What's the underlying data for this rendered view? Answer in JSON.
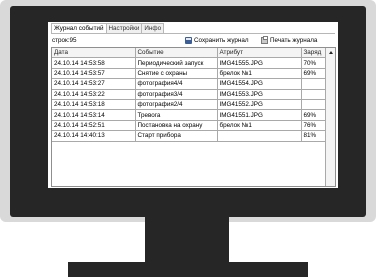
{
  "tabs": [
    "Журнал событий",
    "Настройки",
    "Инфо"
  ],
  "toolbar": {
    "count_label": "строк:95",
    "save_label": "Сохранить журнал",
    "print_label": "Печать журнала"
  },
  "table": {
    "columns": [
      "Дата",
      "Событие",
      "Атрибут",
      "Заряд"
    ],
    "rows": [
      [
        "24.10.14 14:53:58",
        "Периодический запуск",
        "IMG41555.JPG",
        "70%"
      ],
      [
        "24.10.14 14:53:57",
        "Снятие с охраны",
        "брелок №1",
        "69%"
      ],
      [
        "24.10.14 14:53:27",
        "фотография4/4",
        "IMG41554.JPG",
        ""
      ],
      [
        "24.10.14 14:53:22",
        "фотография3/4",
        "IMG41553.JPG",
        ""
      ],
      [
        "24.10.14 14:53:18",
        "фотография2/4",
        "IMG41552.JPG",
        ""
      ],
      [
        "24.10.14 14:53:14",
        "Тревога",
        "IMG41551.JPG",
        "69%"
      ],
      [
        "24.10.14 14:52:51",
        "Постановка на охрану",
        "брелок №1",
        "76%"
      ],
      [
        "24.10.14 14:40:13",
        "Старт прибора",
        "",
        "81%"
      ]
    ]
  },
  "colors": {
    "monitor_frame": "#262626",
    "monitor_body": "#d9d9d9",
    "screen": "#ffffff"
  }
}
